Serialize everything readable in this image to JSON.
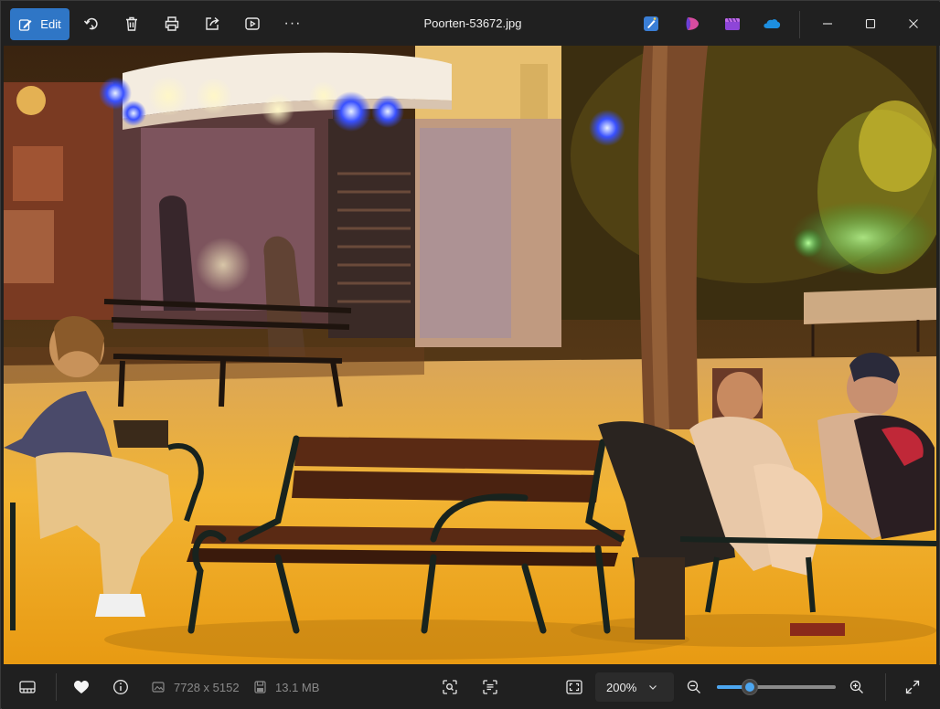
{
  "toolbar": {
    "edit_label": "Edit",
    "actions": [
      "rotate-icon",
      "delete-icon",
      "print-icon",
      "share-icon",
      "slideshow-icon",
      "more-icon"
    ],
    "more_label": "···"
  },
  "window": {
    "title": "Poorten-53672.jpg",
    "apps": [
      "designer-icon",
      "clipchamp-icon",
      "video-editor-icon",
      "onedrive-icon"
    ]
  },
  "photo": {
    "description_icon": "photo-image"
  },
  "statusbar": {
    "dimensions": "7728 x 5152",
    "file_size": "13.1 MB",
    "zoom_value": "200%",
    "zoom_level_fraction": 0.28
  },
  "colors": {
    "accent": "#2f76c6",
    "slider": "#4ca6f0",
    "background": "#202020"
  }
}
